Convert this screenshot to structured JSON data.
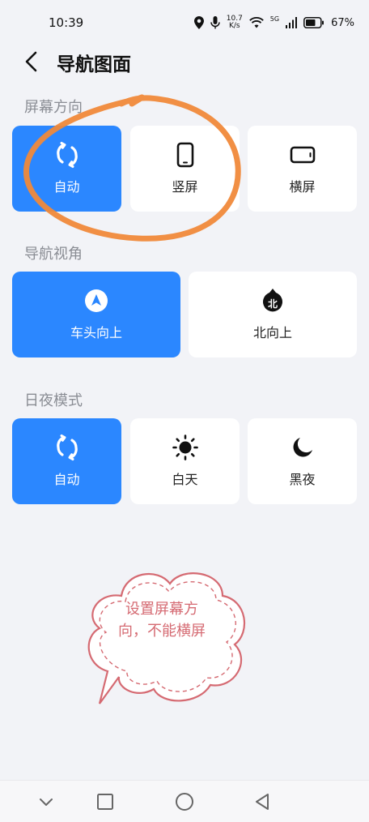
{
  "status": {
    "time": "10:39",
    "net_speed_value": "10.7",
    "net_speed_unit": "K/s",
    "network": "5G",
    "battery": "67%"
  },
  "header": {
    "title": "导航图面"
  },
  "sections": {
    "orientation": {
      "label": "屏幕方向",
      "options": [
        {
          "label": "自动",
          "icon": "auto-rotate-icon",
          "selected": true
        },
        {
          "label": "竖屏",
          "icon": "portrait-phone-icon",
          "selected": false
        },
        {
          "label": "横屏",
          "icon": "landscape-phone-icon",
          "selected": false
        }
      ]
    },
    "view": {
      "label": "导航视角",
      "options": [
        {
          "label": "车头向上",
          "icon": "heading-up-icon",
          "selected": true
        },
        {
          "label": "北向上",
          "icon": "north-up-icon",
          "icon_text": "北",
          "selected": false
        }
      ]
    },
    "daynight": {
      "label": "日夜模式",
      "options": [
        {
          "label": "自动",
          "icon": "auto-rotate-icon",
          "selected": true
        },
        {
          "label": "白天",
          "icon": "sun-icon",
          "selected": false
        },
        {
          "label": "黑夜",
          "icon": "moon-icon",
          "selected": false
        }
      ]
    }
  },
  "annotation": {
    "note": "设置屏幕方向，不能横屏",
    "note_color": "#d56a72",
    "circle_color": "#f0893a"
  },
  "colors": {
    "accent": "#2b87ff",
    "background": "#f2f3f7"
  }
}
